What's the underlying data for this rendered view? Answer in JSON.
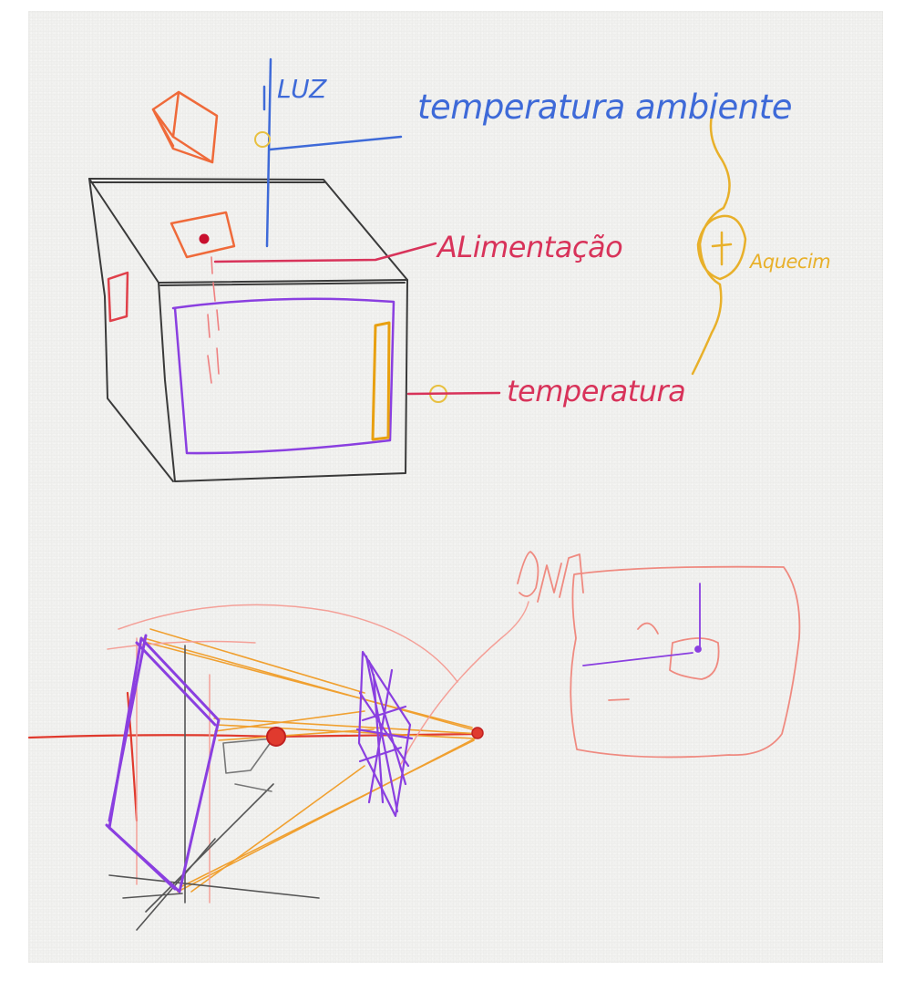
{
  "labels": {
    "luz": "LUZ",
    "temperatura_ambiente": "temperatura ambiente",
    "alimentacao": "ALimentação",
    "aquecimento": "Aquecim",
    "temperatura": "temperatura"
  },
  "colors": {
    "paper": "#f1f1ef",
    "blue": "#3e6ad8",
    "red": "#d8335a",
    "orange": "#ef6a3a",
    "yellow": "#e8b02a",
    "purple": "#8a3fe0",
    "gray": "#3a3a3a",
    "amber": "#f0a030",
    "salmon": "#ef8a80"
  }
}
